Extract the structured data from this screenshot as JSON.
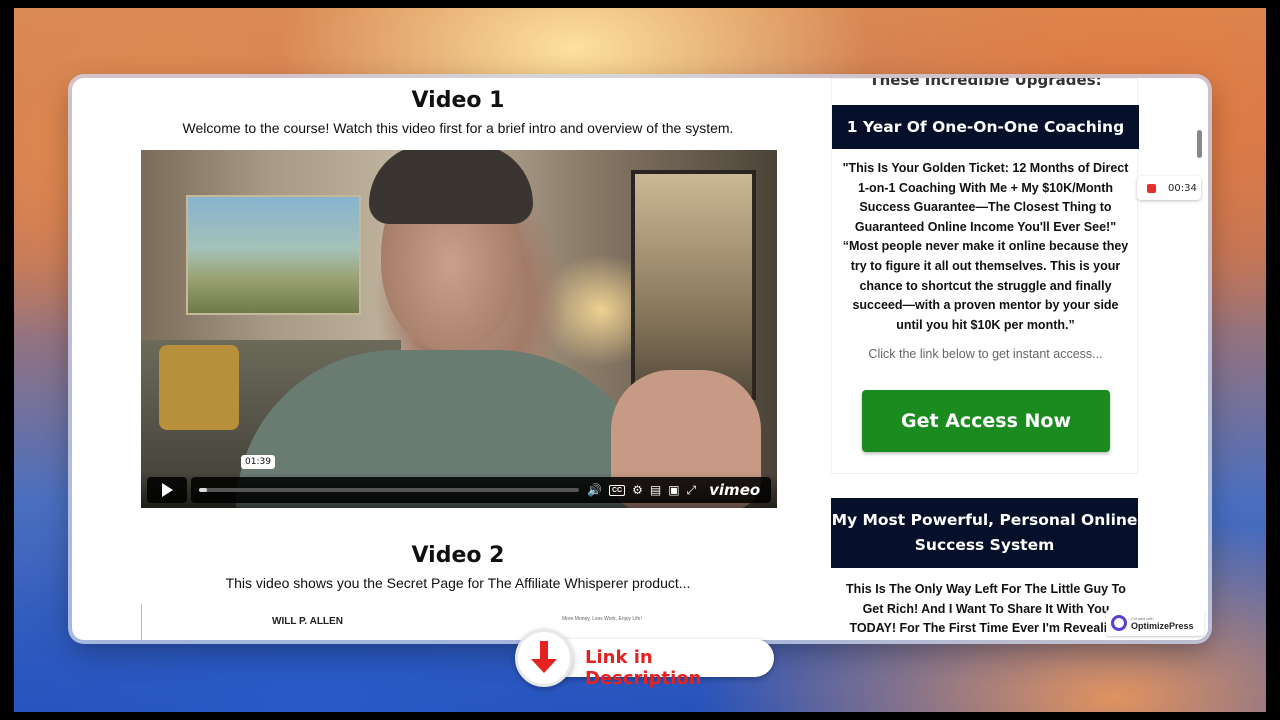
{
  "video1": {
    "title": "Video 1",
    "description": "Welcome to the course! Watch this video first for a brief intro and overview of the system.",
    "player": {
      "time_tooltip": "01:39",
      "progress": 0.02,
      "brand": "vimeo"
    }
  },
  "video2": {
    "title": "Video 2",
    "description": "This video shows you the Secret Page for The Affiliate Whisperer product...",
    "preview": {
      "author": "WILL P. ALLEN",
      "tagline": "More Money, Less Work, Enjoy Life!"
    }
  },
  "sidebar": {
    "partial_heading": "These Incredible Upgrades:",
    "upgrade_banner": "1 Year Of One-On-One Coaching",
    "upgrade_text": "\"This Is Your Golden Ticket: 12 Months of Direct 1-on-1 Coaching With Me + My $10K/Month Success Guarantee—The Closest Thing to Guaranteed Online Income You'll Ever See!\" “Most people never make it online because they try to figure it all out themselves. This is your chance to shortcut the struggle and finally succeed—with a proven mentor by your side until you hit $10K per month.”",
    "click_note": "Click the link below to get instant access...",
    "cta_label": "Get Access Now",
    "system_banner": "My Most Powerful, Personal Online Success System",
    "system_text": "This Is The Only Way Left For The Little Guy To Get Rich! And I Want To Share It With You TODAY! For The First Time Ever I'm Revealing"
  },
  "recorder": {
    "time": "00:34"
  },
  "optimizepress": {
    "small": "Created with",
    "brand": "OptimizePress"
  },
  "overlay": {
    "link_label": "Link in Description"
  },
  "colors": {
    "banner": "#06102a",
    "cta": "#1a8c1f",
    "accent_red": "#e52222"
  }
}
